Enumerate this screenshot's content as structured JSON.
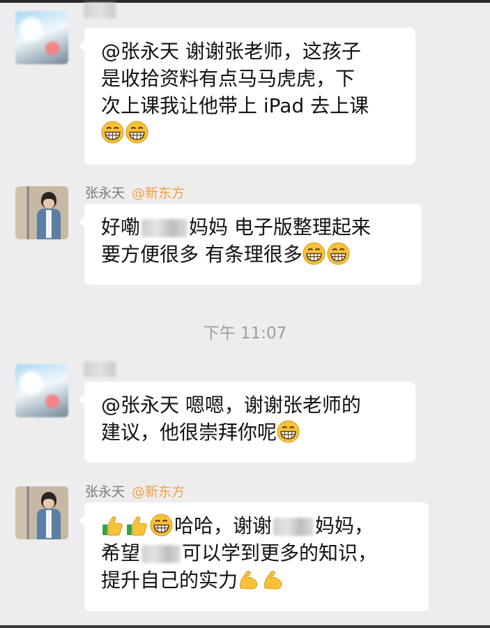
{
  "chat": {
    "timestamp": "下午 11:07",
    "messages": [
      {
        "sender_name": "",
        "lines": [
          [
            "@张永天 谢谢张老师，这孩子"
          ],
          [
            "是收拾资料有点马马虎虎，下"
          ],
          [
            "次上课我让他带上 iPad 去上课"
          ]
        ],
        "emoji_line": [
          "grin",
          "grin"
        ]
      },
      {
        "sender_name": "张永天",
        "sender_org": "@新东方",
        "line1_pre": "好嘞",
        "line1_post": "妈妈 电子版整理起来",
        "line2": "要方便很多 有条理很多",
        "line2_emojis": [
          "grin",
          "grin"
        ]
      },
      {
        "sender_name": "",
        "line1": "@张永天 嗯嗯，谢谢张老师的",
        "line2": "建议，他很崇拜你呢",
        "line2_emojis": [
          "grin"
        ]
      },
      {
        "sender_name": "张永天",
        "sender_org": "@新东方",
        "line1_emojis": [
          "thumbs-up",
          "thumbs-up",
          "grin"
        ],
        "line1_pre": "哈哈，谢谢",
        "line1_post": "妈妈，",
        "line2_pre": "希望",
        "line2_post": "可以学到更多的知识，",
        "line3": "提升自己的实力",
        "line3_emojis": [
          "flexed-biceps",
          "flexed-biceps"
        ]
      }
    ]
  },
  "colors": {
    "background": "#ededed",
    "bubble": "#ffffff",
    "org_accent": "#f0a040",
    "sender_name": "#7a7a7a",
    "timestamp": "#9d9d9d"
  }
}
